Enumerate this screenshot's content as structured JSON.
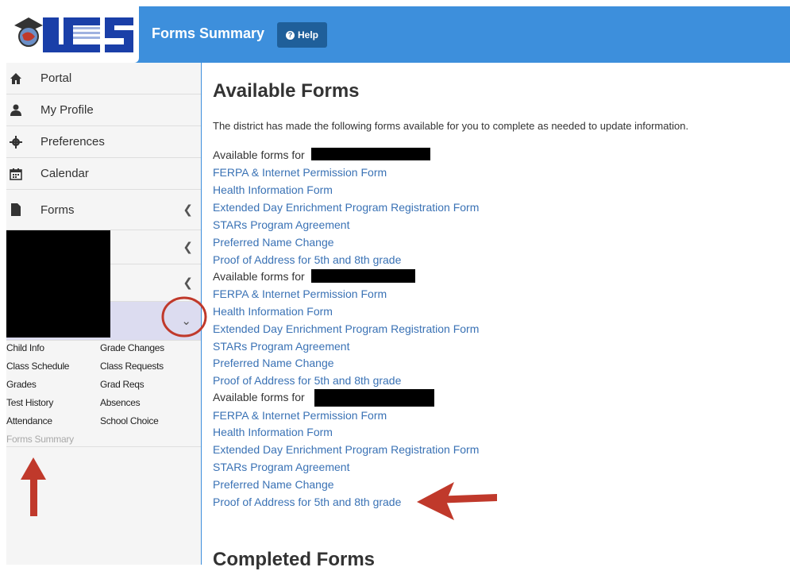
{
  "header": {
    "title": "Forms Summary",
    "help_label": "Help",
    "logo_text": "LCPS",
    "brand_color": "#3d8fdc"
  },
  "sidebar": {
    "items": [
      {
        "label": "Portal",
        "icon": "home-icon"
      },
      {
        "label": "My Profile",
        "icon": "user-icon"
      },
      {
        "label": "Preferences",
        "icon": "gear-icon"
      },
      {
        "label": "Calendar",
        "icon": "calendar-icon"
      },
      {
        "label": "Forms",
        "icon": "file-icon"
      }
    ],
    "student_links": {
      "col1": [
        "Child Info",
        "Class Schedule",
        "Grades",
        "Test History",
        "Attendance",
        "Forms Summary"
      ],
      "col2": [
        "Grade Changes",
        "Class Requests",
        "Grad Reqs",
        "Absences",
        "School Choice"
      ]
    }
  },
  "main": {
    "heading": "Available Forms",
    "intro": "The district has made the following forms available for you to complete as needed to update information.",
    "group_label": "Available forms for",
    "forms": [
      "FERPA & Internet Permission Form",
      "Health Information Form",
      "Extended Day Enrichment Program Registration Form",
      "STARs Program Agreement",
      "Preferred Name Change",
      "Proof of Address for 5th and 8th grade"
    ],
    "completed_heading": "Completed Forms"
  },
  "colors": {
    "link": "#3a72b5",
    "annotation": "#c0392b",
    "redaction": "#000000"
  }
}
